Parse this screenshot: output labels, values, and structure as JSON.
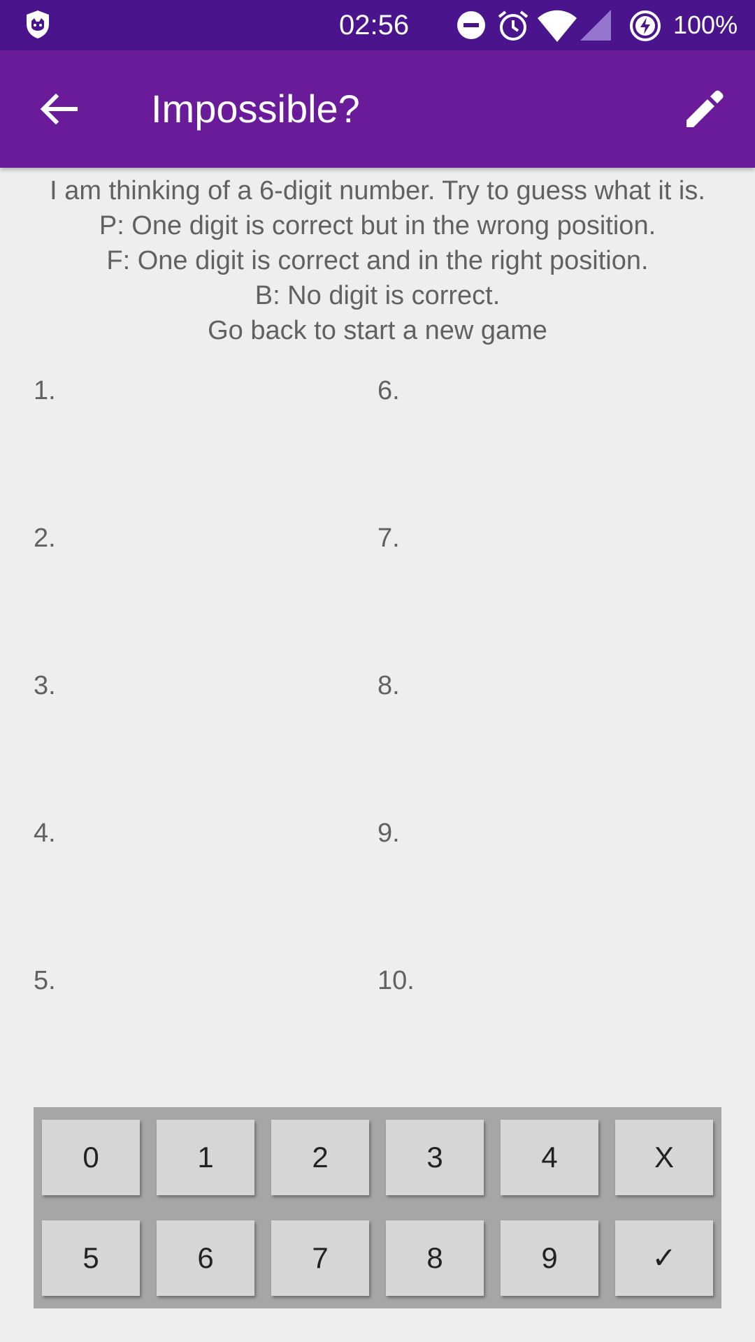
{
  "status_bar": {
    "time": "02:56",
    "battery": "100%",
    "icons": [
      "shield-icon",
      "do-not-disturb-icon",
      "alarm-icon",
      "wifi-icon",
      "cell-signal-icon",
      "battery-charging-icon"
    ],
    "background": "#4a148c"
  },
  "app_bar": {
    "title": "Impossible?",
    "back_icon": "arrow-back-icon",
    "edit_icon": "pencil-icon",
    "background": "#6a1b9a"
  },
  "instructions": [
    "I am thinking of a 6-digit number. Try to guess what it is.",
    "P: One digit is correct but in the wrong position.",
    "F: One digit is correct and in the right position.",
    "B: No digit is correct.",
    "Go back to start a new game"
  ],
  "guesses": {
    "left": [
      "1.",
      "2.",
      "3.",
      "4.",
      "5."
    ],
    "right": [
      "6.",
      "7.",
      "8.",
      "9.",
      "10."
    ]
  },
  "keypad": {
    "row1": [
      "0",
      "1",
      "2",
      "3",
      "4",
      "X"
    ],
    "row2": [
      "5",
      "6",
      "7",
      "8",
      "9",
      "✓"
    ]
  }
}
